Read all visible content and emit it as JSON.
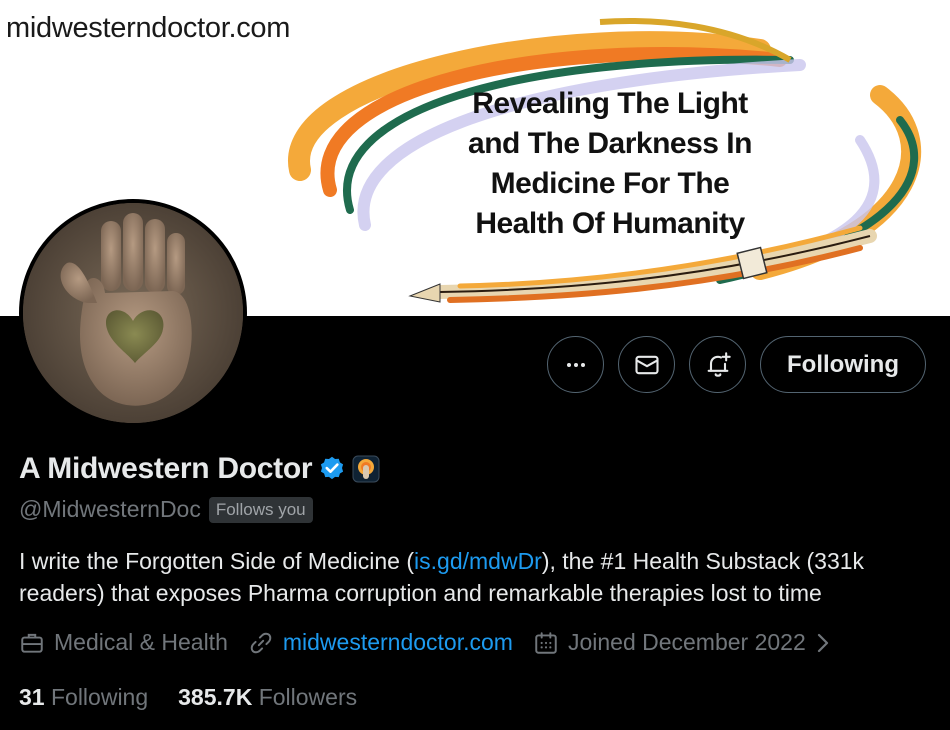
{
  "banner": {
    "site": "midwesterndoctor.com",
    "slogan": [
      "Revealing The Light",
      "and The Darkness In",
      "Medicine For The",
      "Health Of Humanity"
    ]
  },
  "profile": {
    "display_name": "A Midwestern Doctor",
    "handle": "@MidwesternDoc",
    "follows_you": "Follows you",
    "verified_color": "#1d9bf0",
    "bio": {
      "part1": "I write the Forgotten Side of Medicine (",
      "link": "is.gd/mdwDr",
      "part2": "), the #1 Health Substack (331k readers) that exposes Pharma corruption and remarkable therapies lost to time"
    },
    "meta": {
      "category": "Medical & Health",
      "website": "midwesterndoctor.com",
      "joined": "Joined December 2022"
    },
    "stats": {
      "following_count": "31",
      "following_label": "Following",
      "followers_count": "385.7K",
      "followers_label": "Followers"
    }
  },
  "actions": {
    "more_icon": "more-icon",
    "message_icon": "envelope-icon",
    "notify_icon": "bell-plus-icon",
    "follow_label": "Following"
  },
  "colors": {
    "accent": "#1d9bf0",
    "muted": "#71767b",
    "border": "#536471"
  }
}
